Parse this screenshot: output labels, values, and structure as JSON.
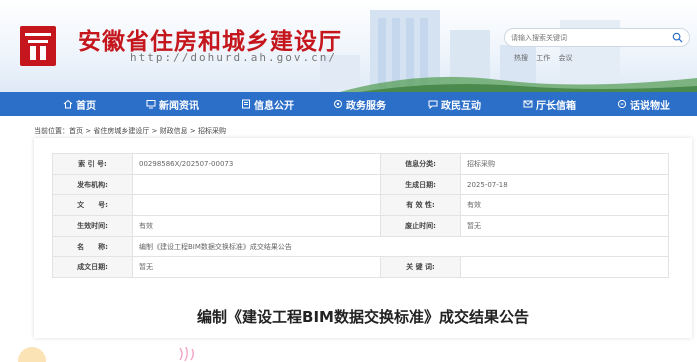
{
  "header": {
    "title": "安徽省住房和城乡建设厅",
    "url": "http://dohurd.ah.gov.cn/",
    "search_placeholder": "请输入搜索关键词",
    "hot_label": "热搜",
    "hot_words": [
      "工作",
      "会议"
    ]
  },
  "nav": {
    "items": [
      {
        "label": "首页",
        "icon": "home-icon"
      },
      {
        "label": "新闻资讯",
        "icon": "monitor-icon"
      },
      {
        "label": "信息公开",
        "icon": "document-icon"
      },
      {
        "label": "政务服务",
        "icon": "service-icon"
      },
      {
        "label": "政民互动",
        "icon": "chat-icon"
      },
      {
        "label": "厅长信箱",
        "icon": "mail-icon"
      },
      {
        "label": "话说物业",
        "icon": "talk-icon"
      }
    ]
  },
  "breadcrumb": "当前位置：首页 > 省住房城乡建设厅 > 财政信息 > 招标采购",
  "meta": {
    "index_label": "索 引 号:",
    "index_value": "002985​86X/202507-00073",
    "category_label": "信息分类:",
    "category_value": "招标采购",
    "publisher_label": "发布机构:",
    "publisher_value": "",
    "gen_date_label": "生成日期:",
    "gen_date_value": "2025-07-18",
    "doc_no_label": "文　　号:",
    "doc_no_value": "",
    "validity_label": "有 效 性:",
    "validity_value": "有效",
    "effective_label": "生效时间:",
    "effective_value": "有效",
    "expire_label": "废止时间:",
    "expire_value": "暂无",
    "name_label": "名　　称:",
    "name_value": "编制《建设工程BIM数据交换标准》成交结果公告",
    "written_label": "成文日期:",
    "written_value": "暂无",
    "keywords_label": "关 键 词:",
    "keywords_value": ""
  },
  "article_title": "编制《建设工程BIM数据交换标准》成交结果公告",
  "colors": {
    "brand_red": "#c4161c",
    "nav_blue": "#2c6fc9"
  }
}
